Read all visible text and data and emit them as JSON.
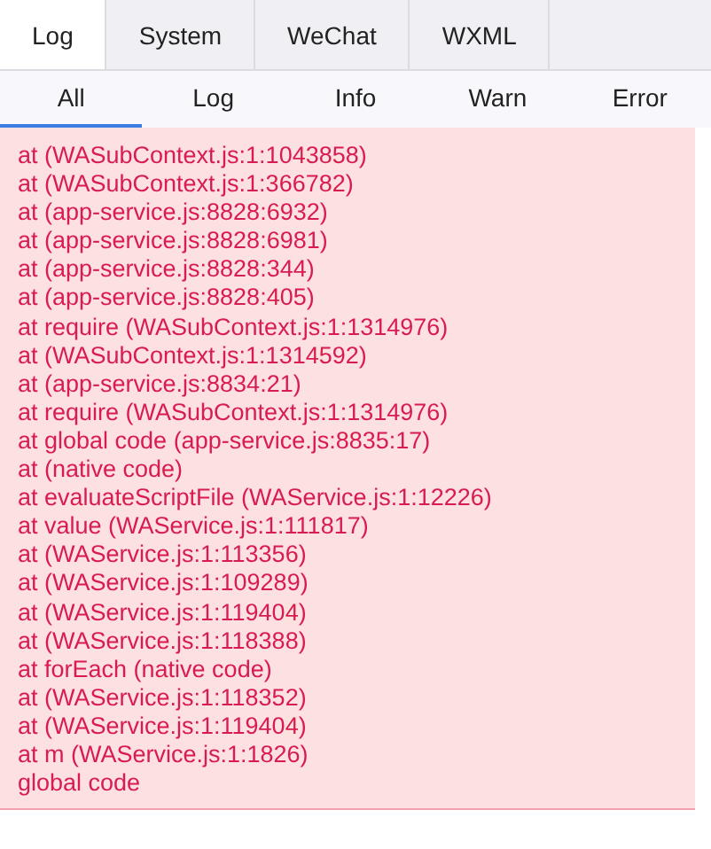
{
  "tabs": [
    {
      "label": "Log",
      "selected": true
    },
    {
      "label": "System",
      "selected": false
    },
    {
      "label": "WeChat",
      "selected": false
    },
    {
      "label": "WXML",
      "selected": false
    }
  ],
  "filters": [
    {
      "label": "All",
      "selected": true
    },
    {
      "label": "Log",
      "selected": false
    },
    {
      "label": "Info",
      "selected": false
    },
    {
      "label": "Warn",
      "selected": false
    },
    {
      "label": "Error",
      "selected": false
    }
  ],
  "log_lines": [
    "at (WASubContext.js:1:1043858)",
    "at (WASubContext.js:1:366782)",
    "at (app-service.js:8828:6932)",
    "at (app-service.js:8828:6981)",
    "at (app-service.js:8828:344)",
    "at (app-service.js:8828:405)",
    "at require (WASubContext.js:1:1314976)",
    "at (WASubContext.js:1:1314592)",
    "at (app-service.js:8834:21)",
    "at require (WASubContext.js:1:1314976)",
    "at global code (app-service.js:8835:17)",
    "at (native code)",
    "at evaluateScriptFile (WAService.js:1:12226)",
    "at value (WAService.js:1:111817)",
    "at (WAService.js:1:113356)",
    "at (WAService.js:1:109289)",
    "at (WAService.js:1:119404)",
    "at (WAService.js:1:118388)",
    "at forEach (native code)",
    "at (WAService.js:1:118352)",
    "at (WAService.js:1:119404)",
    "at m (WAService.js:1:1826)",
    "global code"
  ]
}
